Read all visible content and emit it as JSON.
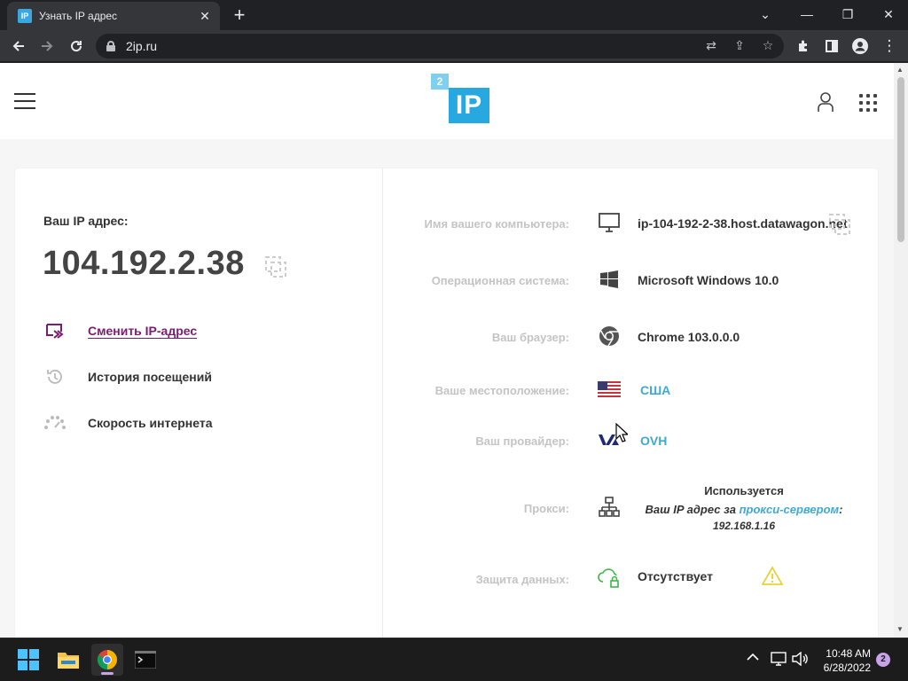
{
  "browser": {
    "tab_title": "Узнать IP адрес",
    "tab_favicon": "IP",
    "url": "2ip.ru",
    "accent": "#35363a"
  },
  "site": {
    "logo_small": "2",
    "logo_main": "IP",
    "ip_label": "Ваш IP адрес:",
    "ip_value": "104.192.2.38",
    "left_menu": [
      {
        "label": "Сменить IP-адрес",
        "icon": "change-ip-icon"
      },
      {
        "label": "История посещений",
        "icon": "history-icon"
      },
      {
        "label": "Скорость интернета",
        "icon": "speed-icon"
      }
    ],
    "rows": {
      "computer_name": {
        "label": "Имя вашего компьютера:",
        "value": "ip-104-192-2-38.host.datawagon.net",
        "icon": "monitor-icon"
      },
      "os": {
        "label": "Операционная система:",
        "value": "Microsoft Windows 10.0",
        "icon": "windows-icon"
      },
      "browser": {
        "label": "Ваш браузер:",
        "value": "Chrome 103.0.0.0",
        "icon": "chrome-icon"
      },
      "location": {
        "label": "Ваше местоположение:",
        "value": "США",
        "icon": "us-flag-icon"
      },
      "provider": {
        "label": "Ваш провайдер:",
        "value": "OVH",
        "icon": "ovh-logo-icon"
      },
      "proxy": {
        "label": "Прокси:",
        "status": "Используется",
        "line_prefix": "Ваш IP адрес за ",
        "line_link": "прокси-сервером",
        "line_suffix": ":",
        "address": "192.168.1.16",
        "icon": "network-icon"
      },
      "protection": {
        "label": "Защита данных:",
        "value": "Отсутствует",
        "icon": "cloud-lock-icon"
      }
    }
  },
  "taskbar": {
    "time": "10:48 AM",
    "date": "6/28/2022",
    "notifications": "2"
  },
  "colors": {
    "link_purple": "#7a1d6f",
    "link_blue": "#3fa9d6",
    "logo_blue": "#27a8e0",
    "warning_yellow": "#e8d33a"
  }
}
